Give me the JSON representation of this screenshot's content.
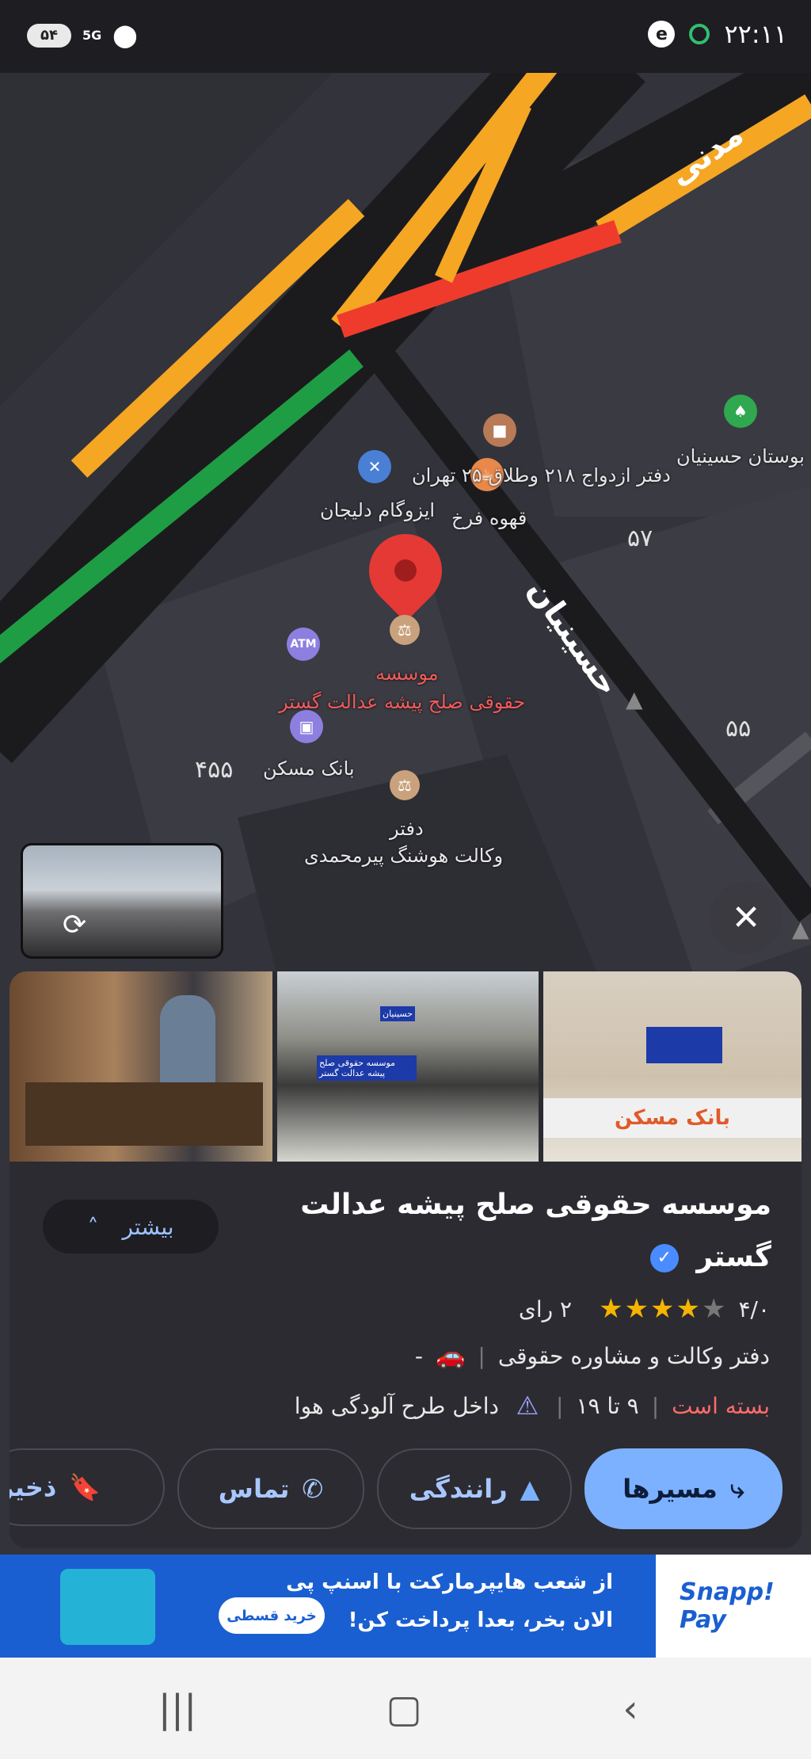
{
  "status_bar": {
    "time": "۲۲:۱۱",
    "battery": "۵۴",
    "network": "5G",
    "icons": [
      "location-icon",
      "app-e-icon",
      "recording-icon"
    ]
  },
  "map": {
    "streets": {
      "madani": "مدنی",
      "hosseinian": "حسینیان"
    },
    "pois": {
      "marriage_office": "دفتر ازدواج ۲۱۸ وطلاق ۲۵ تهران",
      "park": "بوستان حسینیان",
      "isogam": "ایزوگام دلیجان",
      "coffee": "قهوه فرخ",
      "selected_line1": "موسسه",
      "selected_line2": "حقوقی صلح پیشه عدالت گستر",
      "atm": "ATM",
      "bank": "بانک مسکن",
      "lawyer_line1": "دفتر",
      "lawyer_line2": "وکالت هوشنگ پیرمحمدی"
    },
    "numbers": {
      "n57": "۵۷",
      "n55": "۵۵",
      "n455": "۴۵۵"
    },
    "colors": {
      "traffic_slow": "#f5a623",
      "traffic_heavy": "#ef3b2c",
      "traffic_free": "#1f9d45",
      "road": "#1b1b1e",
      "selected_pin": "#e53935"
    }
  },
  "place": {
    "title_line1": "موسسه حقوقی صلح پیشه عدالت",
    "title_line2": "گستر",
    "more_label": "بیشتر",
    "rating": "۴/۰",
    "stars": 4,
    "max_stars": 5,
    "reviews": "۲ رای",
    "category": "دفتر وکالت و مشاوره حقوقی",
    "dash": "-",
    "status": "بسته است",
    "hours": "۹ تا ۱۹",
    "zone": "داخل طرح آلودگی هوا",
    "photo_signs": [
      "موسسه حقوقی صلح پیشه عدالت گستر",
      "بانک مسکن",
      "حسینیان"
    ]
  },
  "actions": {
    "directions": "مسیرها",
    "driving": "رانندگی",
    "call": "تماس",
    "save": "ذخیره"
  },
  "ad": {
    "brand_line1": "Snapp!",
    "brand_line2": "Pay",
    "line1": "از شعب هایپرمارکت با اسنپ پی",
    "line2": "الان بخر، بعدا پرداخت کن!",
    "button": "خرید قسطی"
  }
}
